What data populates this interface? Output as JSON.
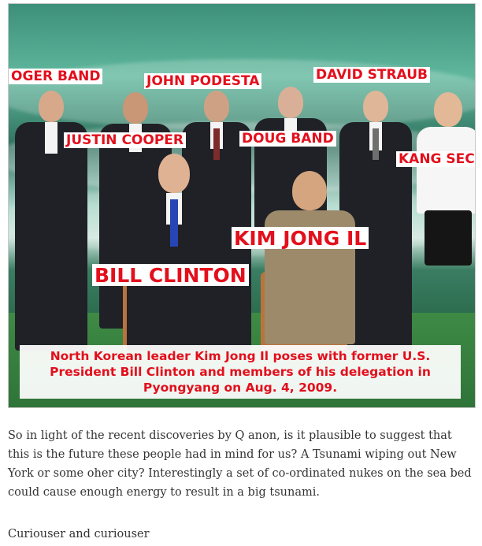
{
  "photo": {
    "labels": {
      "roger_band": "OGER BAND",
      "john_podesta": "JOHN PODESTA",
      "david_straub": "DAVID STRAUB",
      "justin_cooper": "JUSTIN COOPER",
      "doug_band": "DOUG BAND",
      "kang_sec": "KANG SEC",
      "kim_jong_il": "KIM JONG IL",
      "bill_clinton": "BILL CLINTON"
    },
    "caption": "North Korean leader Kim Jong Il poses with former U.S. President Bill Clinton and members of his delegation in Pyongyang on Aug. 4, 2009."
  },
  "article": {
    "paragraph_1": "So in light of the recent discoveries by Q anon, is it plausible to suggest that this is the future these people had in mind for us? A Tsunami wiping out New York or some oher city? Interestingly a set of co-ordinated nukes on the sea bed could cause enough energy to result in a big tsunami.",
    "paragraph_2": "Curiouser and curiouser"
  }
}
